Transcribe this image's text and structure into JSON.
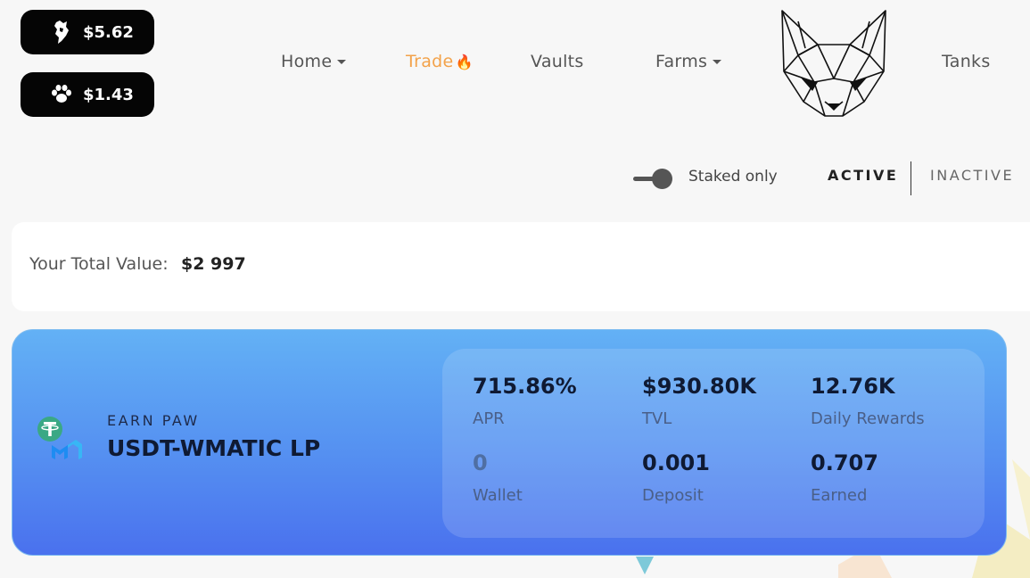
{
  "prices": {
    "kitty": {
      "value": "$5.62",
      "icon": "kitty-token-icon"
    },
    "paw": {
      "value": "$1.43",
      "icon": "paw-token-icon"
    }
  },
  "nav": {
    "home": "Home",
    "trade": "Trade",
    "trade_emoji": "🔥",
    "vaults": "Vaults",
    "farms": "Farms",
    "tanks": "Tanks"
  },
  "filters": {
    "staked_only": "Staked only",
    "active": "ACTIVE",
    "inactive": "INACTIVE"
  },
  "total": {
    "label": "Your Total Value:",
    "value": "$2 997"
  },
  "farm": {
    "earn": "EARN PAW",
    "pair": "USDT-WMATIC LP",
    "apr": "715.86%",
    "apr_label": "APR",
    "tvl": "$930.80K",
    "tvl_label": "TVL",
    "daily_rewards": "12.76K",
    "daily_rewards_label": "Daily Rewards",
    "wallet": "0",
    "wallet_label": "Wallet",
    "deposit": "0.001",
    "deposit_label": "Deposit",
    "earned": "0.707",
    "earned_label": "Earned"
  },
  "colors": {
    "accent": "#f3a24a",
    "card_top": "#63b1f5",
    "card_bottom": "#4a71ee",
    "pill_bg": "#050505"
  }
}
